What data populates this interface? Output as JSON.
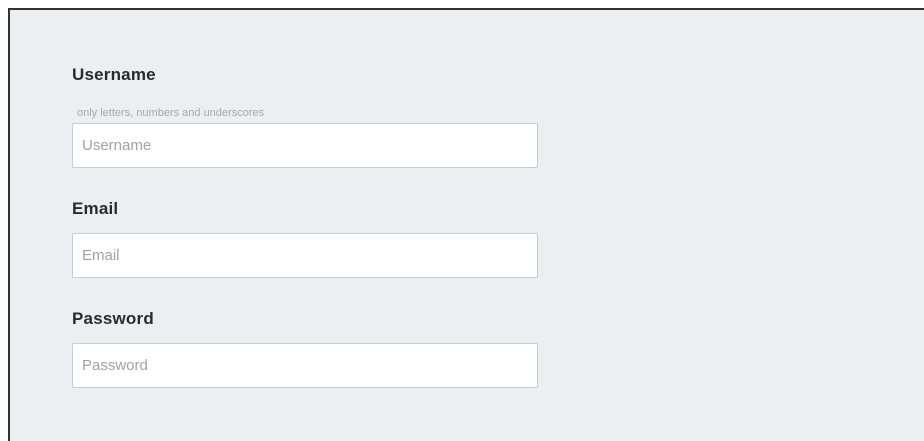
{
  "form": {
    "username": {
      "label": "Username",
      "hint": "only letters, numbers and underscores",
      "placeholder": "Username",
      "value": ""
    },
    "email": {
      "label": "Email",
      "placeholder": "Email",
      "value": ""
    },
    "password": {
      "label": "Password",
      "placeholder": "Password",
      "value": ""
    }
  },
  "colors": {
    "panel_background": "#eceff2",
    "border_dark": "#333333",
    "input_border": "#c8ccd0",
    "hint_text": "#a4a9ad",
    "label_text": "#2b2b2b"
  }
}
